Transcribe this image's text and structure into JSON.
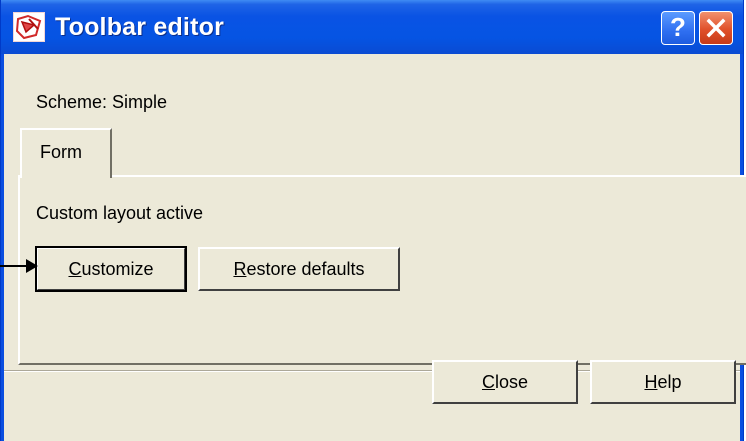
{
  "window": {
    "title": "Toolbar editor",
    "help_glyph": "?",
    "icons": {
      "app": "toolbar-app-icon",
      "help": "help-icon",
      "close": "close-icon"
    }
  },
  "content": {
    "scheme_text": "Scheme: Simple",
    "tab_label": "Form",
    "layout_status": "Custom layout active",
    "customize_button": {
      "pre": "",
      "accel": "C",
      "post": "ustomize"
    },
    "restore_button": {
      "pre": "",
      "accel": "R",
      "post": "estore defaults"
    }
  },
  "footer": {
    "close_button": {
      "pre": "",
      "accel": "C",
      "post": "lose"
    },
    "help_button": {
      "pre": "",
      "accel": "H",
      "post": "elp"
    }
  },
  "annotation": {
    "pointer_icon": "arrow-pointer-icon"
  },
  "colors": {
    "titlebar": "#0554e3",
    "face": "#ece9d8",
    "close_button": "#e0502a"
  }
}
